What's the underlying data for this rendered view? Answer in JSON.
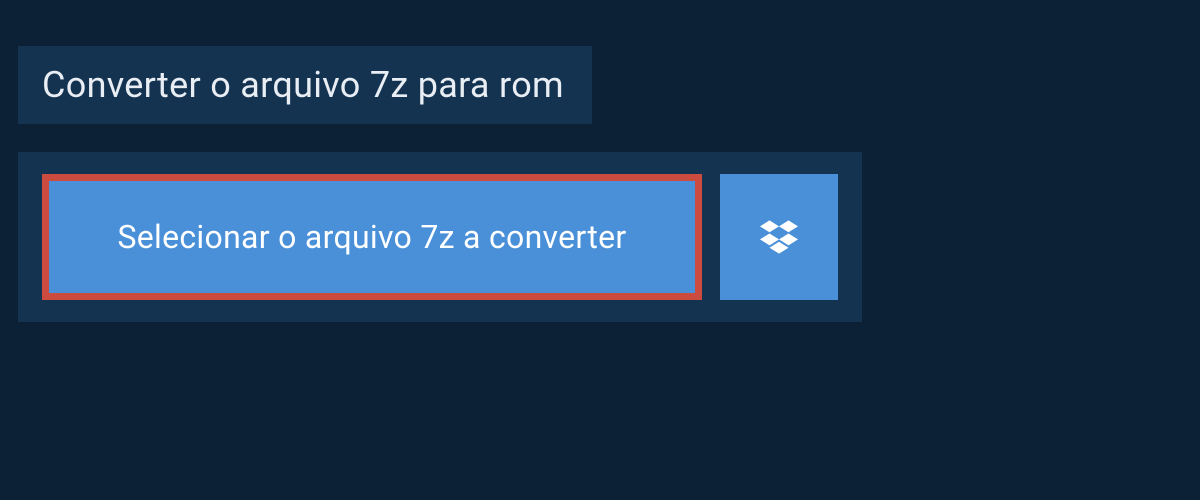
{
  "header": {
    "title": "Converter o arquivo 7z para rom"
  },
  "actions": {
    "select_file_label": "Selecionar o arquivo 7z a converter"
  },
  "colors": {
    "background": "#0c2036",
    "panel": "#143351",
    "button": "#4a90d9",
    "highlight_border": "#cc4b3f",
    "text_light": "#e8eef4",
    "text_white": "#ffffff"
  },
  "icons": {
    "dropbox": "dropbox-icon"
  }
}
